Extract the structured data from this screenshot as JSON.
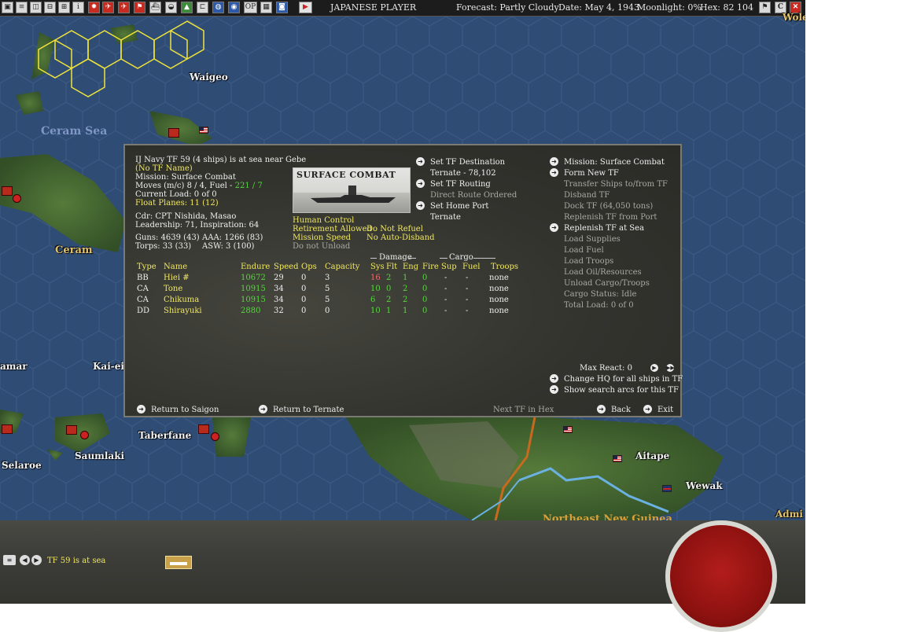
{
  "toolbar": {
    "player": "JAPANESE PLAYER",
    "forecast": "Forecast: Partly Cloudy",
    "date": "Date: May 4, 1943",
    "moonlight": "Moonlight: 0%",
    "hex": "Hex: 82 104",
    "help_label": "C"
  },
  "map": {
    "places": [
      "Waigeo",
      "Ceram",
      "Kai-eil",
      "amar",
      "Taberfane",
      "Saumlaki",
      "Selaroe",
      "Aitape",
      "Wewak",
      "Admi",
      "Wole"
    ],
    "seas": [
      "Ceram Sea",
      "Northeast New Guinea"
    ]
  },
  "tf": {
    "header": "IJ Navy TF 59 (4 ships) is at sea near Gebe",
    "name": "(No TF Name)",
    "mission": "Mission: Surface Combat",
    "moves_prefix": "Moves (m/c) 8 / 4, Fuel - ",
    "moves_fuel": "221 / 7",
    "current_load": "Current Load: 0 of 0",
    "float_planes": "Float Planes: 11 (12)",
    "commander": "Cdr: CPT Nishida, Masao",
    "leadership": "Leadership: 71, Inspiration: 64",
    "guns": "Guns: 4639 (43)",
    "aaa": "AAA: 1266 (83)",
    "torps": "Torps: 33 (33)",
    "asw": "ASW: 3 (100)",
    "mission_image_label": "SURFACE COMBAT",
    "human_control": "Human Control",
    "retirement": "Retirement Allowed",
    "mission_speed": "Mission Speed",
    "do_not_unload": "Do not Unload",
    "do_not_refuel": "Do Not Refuel",
    "no_auto_disband": "No Auto-Disband",
    "set_destination": "Set TF Destination",
    "destination": "Ternate - 78,102",
    "set_routing": "Set TF Routing",
    "route": "Direct Route Ordered",
    "set_home": "Set Home Port",
    "home": "Ternate",
    "damage_group": "Damage",
    "cargo_group": "Cargo",
    "columns": [
      "Type",
      "Name",
      "Endure",
      "Speed",
      "Ops",
      "Capacity",
      "Sys",
      "Flt",
      "Eng",
      "Fire",
      "Sup",
      "Fuel",
      "Troops"
    ],
    "ships": [
      {
        "type": "BB",
        "name": "Hiei #",
        "endure": "10672",
        "speed": "29",
        "ops": "0",
        "capacity": "3",
        "sys": "16",
        "flt": "2",
        "eng": "1",
        "fire": "0",
        "sup": "-",
        "fuel": "-",
        "troops": "none"
      },
      {
        "type": "CA",
        "name": "Tone",
        "endure": "10915",
        "speed": "34",
        "ops": "0",
        "capacity": "5",
        "sys": "10",
        "flt": "0",
        "eng": "2",
        "fire": "0",
        "sup": "-",
        "fuel": "-",
        "troops": "none"
      },
      {
        "type": "CA",
        "name": "Chikuma",
        "endure": "10915",
        "speed": "34",
        "ops": "0",
        "capacity": "5",
        "sys": "6",
        "flt": "2",
        "eng": "2",
        "fire": "0",
        "sup": "-",
        "fuel": "-",
        "troops": "none"
      },
      {
        "type": "DD",
        "name": "Shirayuki",
        "endure": "2880",
        "speed": "32",
        "ops": "0",
        "capacity": "0",
        "sys": "10",
        "flt": "1",
        "eng": "1",
        "fire": "0",
        "sup": "-",
        "fuel": "-",
        "troops": "none"
      }
    ],
    "right_menu": {
      "mission": "Mission: Surface Combat",
      "form_new": "Form New TF",
      "transfer": "Transfer Ships to/from TF",
      "disband": "Disband TF",
      "dock": "Dock TF (64,050 tons)",
      "replenish_port": "Replenish TF from Port",
      "replenish_sea": "Replenish TF at Sea",
      "load_supplies": "Load Supplies",
      "load_fuel": "Load Fuel",
      "load_troops": "Load Troops",
      "load_oil": "Load Oil/Resources",
      "unload": "Unload Cargo/Troops",
      "cargo_status": "Cargo Status: Idle",
      "total_load": "Total Load: 0 of 0"
    },
    "max_react": "Max React: 0",
    "change_hq": "Change HQ for all ships in TF",
    "show_arcs": "Show search arcs for this TF",
    "return_saigon": "Return to Saigon",
    "return_ternate": "Return to Ternate",
    "next_tf": "Next TF in Hex",
    "back": "Back",
    "exit": "Exit"
  },
  "bottom": {
    "status": "TF 59 is at sea"
  }
}
